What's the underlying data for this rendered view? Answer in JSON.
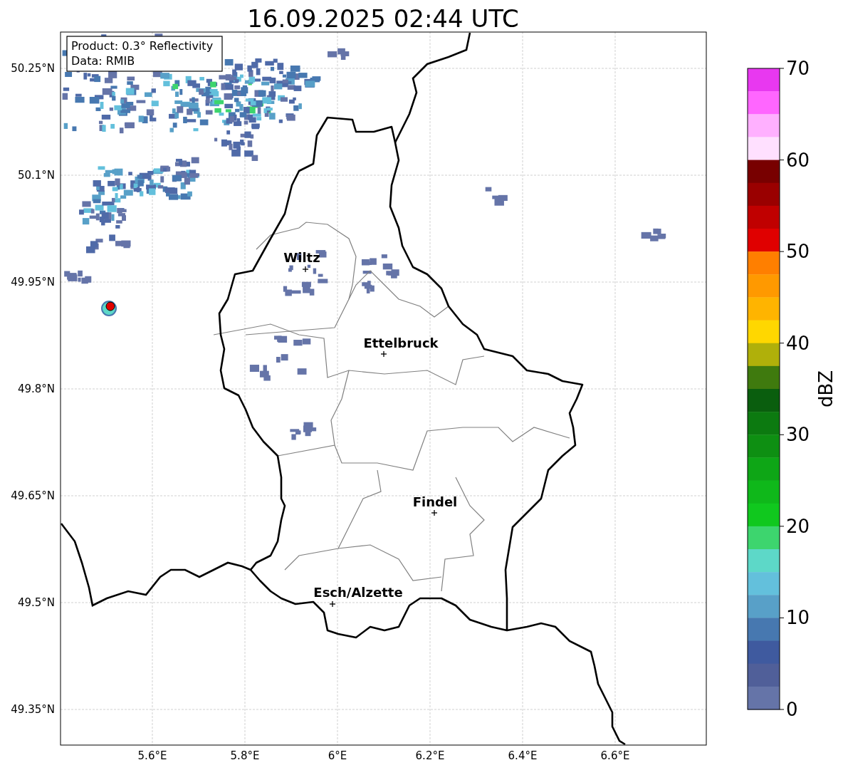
{
  "title": "16.09.2025 02:44 UTC",
  "info_box": [
    "Product: 0.3° Reflectivity",
    "Data: RMIB"
  ],
  "lat_ticks": [
    "50.25°N",
    "50.1°N",
    "49.95°N",
    "49.8°N",
    "49.65°N",
    "49.5°N",
    "49.35°N"
  ],
  "lon_ticks": [
    "5.6°E",
    "5.8°E",
    "6°E",
    "6.2°E",
    "6.4°E",
    "6.6°E"
  ],
  "cities": [
    {
      "name": "Wiltz"
    },
    {
      "name": "Ettelbruck"
    },
    {
      "name": "Findel"
    },
    {
      "name": "Esch/Alzette"
    }
  ],
  "colorbar": {
    "label": "dBZ",
    "ticks": [
      "70",
      "60",
      "50",
      "40",
      "30",
      "20",
      "10",
      "0"
    ],
    "colors": [
      {
        "color": "#e838f0"
      },
      {
        "color": "#ff66ff"
      },
      {
        "color": "#ffb0ff"
      },
      {
        "color": "#ffe0ff"
      },
      {
        "color": "#780000"
      },
      {
        "color": "#9a0000"
      },
      {
        "color": "#c00000"
      },
      {
        "color": "#e00000"
      },
      {
        "color": "#ff7f00"
      },
      {
        "color": "#ff9900"
      },
      {
        "color": "#ffb400"
      },
      {
        "color": "#ffd700"
      },
      {
        "color": "#b0b00a"
      },
      {
        "color": "#3f7a0e"
      },
      {
        "color": "#0a5e0e"
      },
      {
        "color": "#0c7a10"
      },
      {
        "color": "#0e8f12"
      },
      {
        "color": "#0ea616"
      },
      {
        "color": "#0fb81a"
      },
      {
        "color": "#10c81e"
      },
      {
        "color": "#3dd56e"
      },
      {
        "color": "#5dd8c8"
      },
      {
        "color": "#63c0dc"
      },
      {
        "color": "#58a0c8"
      },
      {
        "color": "#4778b0"
      },
      {
        "color": "#3f5a9f"
      },
      {
        "color": "#505f99"
      },
      {
        "color": "#6574a8"
      }
    ]
  }
}
